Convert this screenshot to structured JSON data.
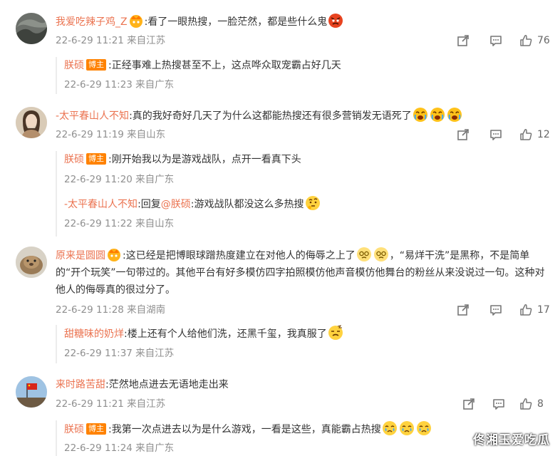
{
  "comments": [
    {
      "user": "我爱吃辣子鸡_Z",
      "text": ":看了一眼热搜，一脸茫然，都是些什么鬼",
      "meta": "22-6-29 11:21 来自江苏",
      "likes": "76",
      "replies": [
        {
          "user": "朕硕",
          "badge": "博主",
          "text": ":正经事难上热搜甚至不上，这点哗众取宠霸占好几天",
          "meta": "22-6-29 11:23 来自广东"
        }
      ]
    },
    {
      "user": "-太平春山人不知",
      "text": ":真的我好奇好几天了为什么这都能热搜还有很多营销发无语死了",
      "meta": "22-6-29 11:19 来自山东",
      "likes": "12",
      "replies": [
        {
          "user": "朕硕",
          "badge": "博主",
          "text": ":刚开始我以为是游戏战队，点开一看真下头",
          "meta": "22-6-29 11:20 来自广东"
        },
        {
          "user": "-太平春山人不知",
          "prefix": ":回复",
          "mention": "@朕硕",
          "text": ":游戏战队都没这么多热搜",
          "meta": "22-6-29 11:22 来自山东"
        }
      ]
    },
    {
      "user": "原来是圆圆",
      "text1": ":这已经是把博眼球蹭热度建立在对他人的侮辱之上了",
      "text2": "，“易烊干洗”是黑称，不是简单的“开个玩笑”一句带过的。其他平台有好多模仿四字拍照模仿他声音模仿他舞台的粉丝从来没说过一句。这种对他人的侮辱真的很过分了。",
      "meta": "22-6-29 11:28 来自湖南",
      "likes": "17",
      "replies": [
        {
          "user": "甜糖味的奶烊",
          "text": ":楼上还有个人给他们洗，还黑千玺，我真服了",
          "meta": "22-6-29 11:37 来自江苏"
        }
      ]
    },
    {
      "user": "来时路苦甜",
      "text": ":茫然地点进去无语地走出来",
      "meta": "22-6-29 11:21 来自江苏",
      "likes": "8",
      "replies": [
        {
          "user": "朕硕",
          "badge": "博主",
          "text": ":我第一次点进去以为是什么游戏，一看是这些，真能霸占热搜",
          "meta": "22-6-29 11:24 来自广东"
        }
      ]
    }
  ],
  "watermark": "佟湘玉爱吃瓜",
  "colors": {
    "username": "#eb7350",
    "badge": "#ff8200",
    "meta": "#8f8f8f"
  }
}
